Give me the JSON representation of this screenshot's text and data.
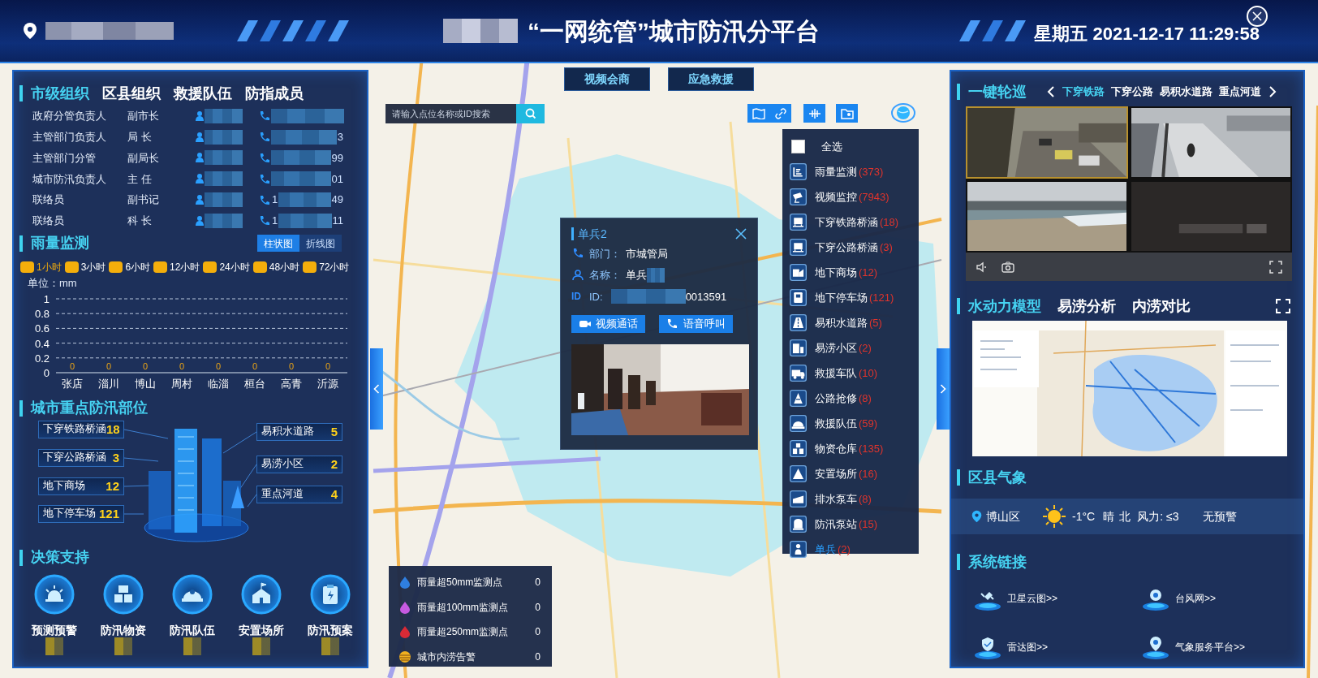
{
  "header": {
    "title": "“一网统管”城市防汛分平台",
    "clock": "星期五 2021-12-17 11:29:58"
  },
  "left_panel": {
    "org_tabs": [
      {
        "label": "市级组织",
        "selected": true
      },
      {
        "label": "区县组织",
        "selected": false
      },
      {
        "label": "救援队伍",
        "selected": false
      },
      {
        "label": "防指成员",
        "selected": false
      }
    ],
    "contacts": [
      {
        "role": "政府分管负责人",
        "title": "副市长"
      },
      {
        "role": "主管部门负责人",
        "title": "局 长",
        "phone_tail": "3"
      },
      {
        "role": "主管部门分管",
        "title": "副局长",
        "phone_tail": "99"
      },
      {
        "role": "城市防汛负责人",
        "title": "主 任",
        "phone_tail": "01"
      },
      {
        "role": "联络员",
        "title": "副书记",
        "phone_head": "1",
        "phone_tail": "49"
      },
      {
        "role": "联络员",
        "title": "科 长",
        "phone_head": "1",
        "phone_tail": "11"
      }
    ],
    "rainfall": {
      "title": "雨量监测",
      "chart_types": [
        {
          "label": "柱状图",
          "selected": true
        },
        {
          "label": "折线图",
          "selected": false
        }
      ],
      "periods": [
        {
          "label": "1小时",
          "selected": true
        },
        {
          "label": "3小时",
          "selected": false
        },
        {
          "label": "6小时",
          "selected": false
        },
        {
          "label": "12小时",
          "selected": false
        },
        {
          "label": "24小时",
          "selected": false
        },
        {
          "label": "48小时",
          "selected": false
        },
        {
          "label": "72小时",
          "selected": false
        }
      ],
      "chart_data": {
        "type": "bar",
        "ylabel": "单位：mm",
        "categories": [
          "张店",
          "淄川",
          "博山",
          "周村",
          "临淄",
          "桓台",
          "高青",
          "沂源"
        ],
        "values": [
          0,
          0,
          0,
          0,
          0,
          0,
          0,
          0
        ],
        "ylim": [
          0,
          1
        ],
        "yticks": [
          0,
          0.2,
          0.4,
          0.6,
          0.8,
          1
        ],
        "grid": true,
        "data_labels": true
      }
    },
    "key_sites": {
      "title": "城市重点防汛部位",
      "left_items": [
        {
          "label": "下穿铁路桥涵",
          "count": "18"
        },
        {
          "label": "下穿公路桥涵",
          "count": "3"
        },
        {
          "label": "地下商场",
          "count": "12"
        },
        {
          "label": "地下停车场",
          "count": "121"
        }
      ],
      "right_items": [
        {
          "label": "易积水道路",
          "count": "5"
        },
        {
          "label": "易涝小区",
          "count": "2"
        },
        {
          "label": "重点河道",
          "count": "4"
        }
      ]
    },
    "decision": {
      "title": "决策支持",
      "items": [
        {
          "label": "预测预警",
          "kind": "alarm"
        },
        {
          "label": "防汛物资",
          "kind": "boxes"
        },
        {
          "label": "防汛队伍",
          "kind": "team"
        },
        {
          "label": "安置场所",
          "kind": "shelter"
        },
        {
          "label": "防汛预案",
          "kind": "plan"
        }
      ]
    }
  },
  "map": {
    "top_buttons": [
      "视频会商",
      "应急救援"
    ],
    "search": {
      "placeholder": "请输入点位名称或ID搜索"
    },
    "layers": {
      "select_all": {
        "label": "全选",
        "checked": false
      },
      "items": [
        {
          "label": "雨量监测",
          "count": "(373)",
          "kind": "gauge",
          "selected": false
        },
        {
          "label": "视频监控",
          "count": "(7943)",
          "kind": "camera",
          "selected": false
        },
        {
          "label": "下穿铁路桥涵",
          "count": "(18)",
          "kind": "bridge",
          "selected": false
        },
        {
          "label": "下穿公路桥涵",
          "count": "(3)",
          "kind": "bridge",
          "selected": false
        },
        {
          "label": "地下商场",
          "count": "(12)",
          "kind": "store",
          "selected": false
        },
        {
          "label": "地下停车场",
          "count": "(121)",
          "kind": "parking",
          "selected": false
        },
        {
          "label": "易积水道路",
          "count": "(5)",
          "kind": "road",
          "selected": false
        },
        {
          "label": "易涝小区",
          "count": "(2)",
          "kind": "housing",
          "selected": false
        },
        {
          "label": "救援车队",
          "count": "(10)",
          "kind": "truck",
          "selected": false
        },
        {
          "label": "公路抢修",
          "count": "(8)",
          "kind": "repair",
          "selected": false
        },
        {
          "label": "救援队伍",
          "count": "(59)",
          "kind": "team",
          "selected": false
        },
        {
          "label": "物资仓库",
          "count": "(135)",
          "kind": "boxes",
          "selected": false
        },
        {
          "label": "安置场所",
          "count": "(16)",
          "kind": "tent",
          "selected": false
        },
        {
          "label": "排水泵车",
          "count": "(8)",
          "kind": "pump_truck",
          "selected": false
        },
        {
          "label": "防汛泵站",
          "count": "(15)",
          "kind": "station",
          "selected": false
        },
        {
          "label": "单兵",
          "count": "(2)",
          "kind": "person",
          "selected": true
        }
      ]
    },
    "popup": {
      "title": "单兵2",
      "fields": [
        {
          "kind": "phone",
          "label": "部门：",
          "value": "市城管局"
        },
        {
          "kind": "person",
          "label": "名称：",
          "value": "单兵"
        },
        {
          "kind": "id",
          "tag": "ID",
          "label": "ID:",
          "value": "0013591"
        }
      ],
      "buttons": [
        {
          "kind": "video",
          "label": "视频通话"
        },
        {
          "kind": "phone",
          "label": "语音呼叫"
        }
      ]
    },
    "legend": [
      {
        "kind": "drop",
        "label": "雨量超50mm监测点",
        "value": "0",
        "color": "#2f7fe0"
      },
      {
        "kind": "drop",
        "label": "雨量超100mm监测点",
        "value": "0",
        "color": "#c65ae0"
      },
      {
        "kind": "drop",
        "label": "雨量超250mm监测点",
        "value": "0",
        "color": "#d92a36"
      },
      {
        "kind": "ball",
        "label": "城市内涝告警",
        "value": "0",
        "color": "#f0b020"
      }
    ]
  },
  "right_panel": {
    "patrol": {
      "title": "一键轮巡",
      "tabs": [
        {
          "label": "下穿铁路",
          "selected": true
        },
        {
          "label": "下穿公路",
          "selected": false
        },
        {
          "label": "易积水道路",
          "selected": false
        },
        {
          "label": "重点河道",
          "selected": false
        }
      ]
    },
    "videos": [
      {
        "selected": true
      },
      {
        "selected": false
      },
      {
        "selected": false
      },
      {
        "selected": false
      }
    ],
    "model_tabs": [
      {
        "label": "水动力模型",
        "selected": true
      },
      {
        "label": "易涝分析",
        "selected": false
      },
      {
        "label": "内涝对比",
        "selected": false
      }
    ],
    "weather": {
      "title": "区县气象",
      "district": "博山区",
      "temperature": "-1°C",
      "condition": "晴",
      "wind_direction": "北",
      "wind_force": "风力: ≤3",
      "warning": "无预警"
    },
    "links": {
      "title": "系统链接",
      "items": [
        {
          "label": "卫星云图>>",
          "kind": "satellite"
        },
        {
          "label": "台风网>>",
          "kind": "typhoon"
        },
        {
          "label": "雷达图>>",
          "kind": "radar"
        },
        {
          "label": "气象服务平台>>",
          "kind": "weather"
        }
      ]
    }
  }
}
